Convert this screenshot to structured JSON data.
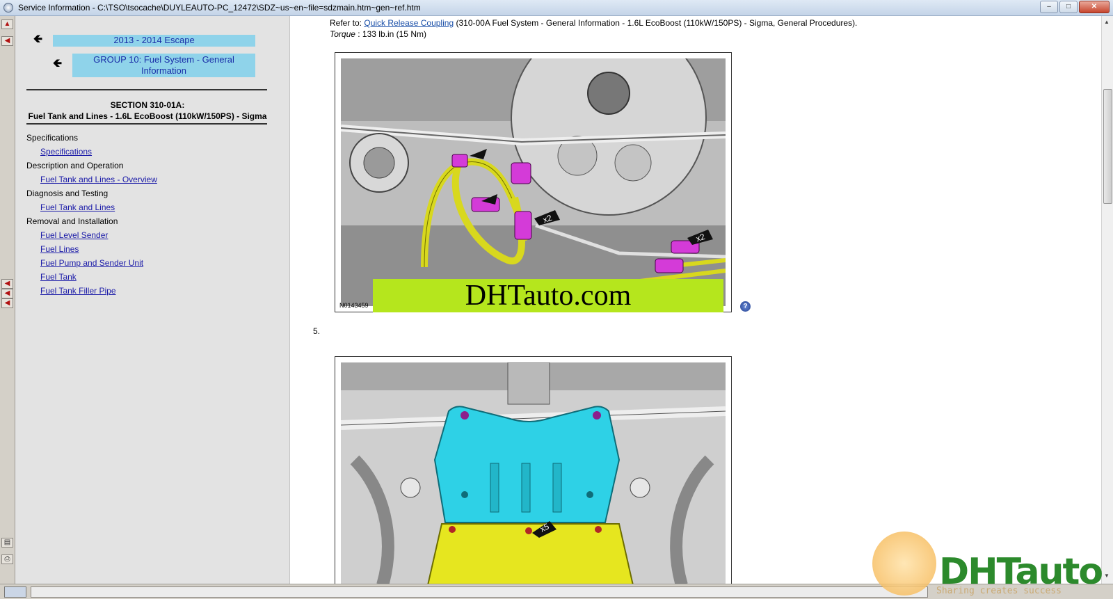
{
  "window": {
    "title": "Service Information - C:\\TSO\\tsocache\\DUYLEAUTO-PC_12472\\SDZ~us~en~file=sdzmain.htm~gen~ref.htm",
    "minimize": "–",
    "maximize": "□",
    "close": "✕"
  },
  "nav": {
    "back_glyph": "🡸",
    "crumb_vehicle": "2013 - 2014 Escape",
    "crumb_group": "GROUP 10: Fuel System - General Information",
    "section_heading": "SECTION 310-01A:",
    "section_name": "Fuel Tank and Lines - 1.6L EcoBoost (110kW/150PS) - Sigma",
    "categories": [
      {
        "label": "Specifications",
        "links": [
          "Specifications"
        ]
      },
      {
        "label": "Description and Operation",
        "links": [
          "Fuel Tank and Lines - Overview"
        ]
      },
      {
        "label": "Diagnosis and Testing",
        "links": [
          "Fuel Tank and Lines"
        ]
      },
      {
        "label": "Removal and Installation",
        "links": [
          "Fuel Level Sender",
          "Fuel Lines",
          "Fuel Pump and Sender Unit",
          "Fuel Tank",
          "Fuel Tank Filler Pipe"
        ]
      }
    ]
  },
  "content": {
    "refer_prefix": "Refer to:",
    "refer_link": "Quick Release Coupling",
    "refer_suffix": "(310-00A Fuel System - General Information - 1.6L EcoBoost (110kW/150PS) - Sigma, General Procedures).",
    "torque_label": "Torque",
    "torque_value": ": 133 lb.in (15 Nm)",
    "figure1_id": "N0143459",
    "figure1_callouts": [
      "x2",
      "x2"
    ],
    "watermark_banner": "DHTauto.com",
    "step_number": "5.",
    "figure2_callouts": [
      "x5"
    ],
    "help_glyph": "?"
  },
  "brand": {
    "name": "DHTauto",
    "tagline": "Sharing creates success"
  },
  "colors": {
    "crumb_bg": "#8fd3ea",
    "link": "#1a1aa8",
    "banner": "#b5e61d",
    "fuel_line": "#d8d81e",
    "coupling": "#d43bd8",
    "shield": "#2ed1e6"
  }
}
